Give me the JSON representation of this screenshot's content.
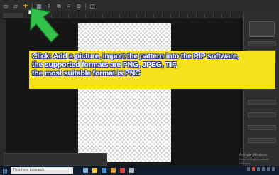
{
  "toolbar": {
    "buttons": [
      {
        "name": "new-file-icon",
        "glyph": "▭"
      },
      {
        "name": "open-folder-icon",
        "glyph": "▱"
      },
      {
        "name": "add-picture-icon",
        "glyph": "✚"
      },
      {
        "name": "grid-icon",
        "glyph": "▦"
      },
      {
        "name": "text-icon",
        "glyph": "T"
      },
      {
        "name": "copy-icon",
        "glyph": "⧉"
      },
      {
        "name": "align-icon",
        "glyph": "≡"
      },
      {
        "name": "zoom-icon",
        "glyph": "⊕"
      },
      {
        "name": "layers-icon",
        "glyph": "◫"
      }
    ]
  },
  "taskbar": {
    "start_glyph": "⊞",
    "search_placeholder": "Type here to search",
    "app_icon_colors": [
      "#7fb0e6",
      "#f0c64a",
      "#4a8fd8",
      "#e0a030",
      "#d94848",
      "#bbbbbb"
    ]
  },
  "watermark": {
    "title": "Activate Windows",
    "subtitle": "Go to Settings to activate Windows."
  },
  "annotation": {
    "line1": "Click: Add a picture, import the pattern into the RIP software,",
    "line2": "the supported formats are PNG, JPEG, TIF,",
    "line3": "the most suitable format is PNG",
    "background_color": "#f5e21a",
    "arrow_color": "#33c24a"
  }
}
